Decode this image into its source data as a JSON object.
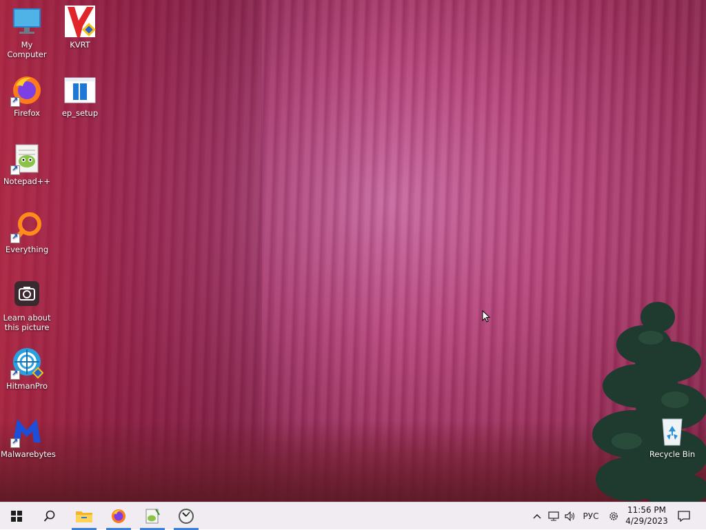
{
  "desktop": {
    "icons": [
      {
        "label": "My Computer"
      },
      {
        "label": "KVRT"
      },
      {
        "label": "Firefox"
      },
      {
        "label": "ep_setup"
      },
      {
        "label": "Notepad++"
      },
      {
        "label": "Everything"
      },
      {
        "label": "Learn about this picture"
      },
      {
        "label": "HitmanPro"
      },
      {
        "label": "Malwarebytes"
      },
      {
        "label": "Recycle Bin"
      }
    ]
  },
  "taskbar": {
    "pinned": [
      {
        "icon": "windows-start-icon"
      },
      {
        "icon": "search-icon"
      },
      {
        "icon": "file-explorer-icon",
        "running": true
      },
      {
        "icon": "firefox-icon",
        "running": true
      },
      {
        "icon": "notepad-plus-plus-icon",
        "running": true
      },
      {
        "icon": "clock-app-icon",
        "running": true
      }
    ],
    "tray": {
      "language": "РУС",
      "time": "11:56 PM",
      "date": "4/29/2023"
    }
  },
  "colors": {
    "taskbar_bg": "#f0ecf2",
    "running_indicator": "#3b7fd6"
  }
}
